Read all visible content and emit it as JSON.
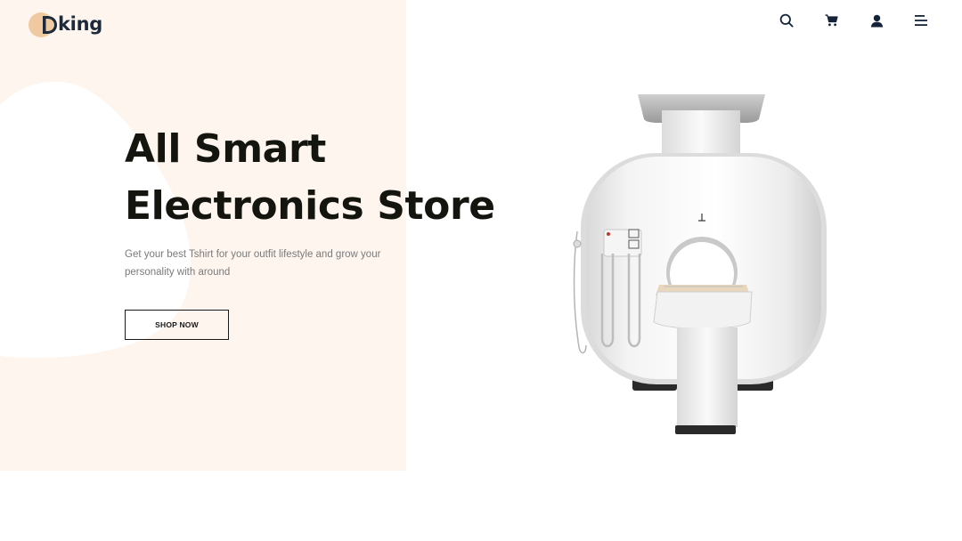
{
  "brand": {
    "logo_text": "king",
    "accent_color": "#f0c9a0",
    "mark_color": "#1d2a3c"
  },
  "nav": {
    "icons": [
      "search-icon",
      "cart-icon",
      "user-icon",
      "menu-icon"
    ]
  },
  "hero": {
    "title_line1": "All Smart",
    "title_line2": "Electronics Store",
    "description": "Get your best Tshirt for your outfit lifestyle and grow your personality with around",
    "cta_label": "SHOP NOW",
    "background_color": "#fdf5ee"
  }
}
